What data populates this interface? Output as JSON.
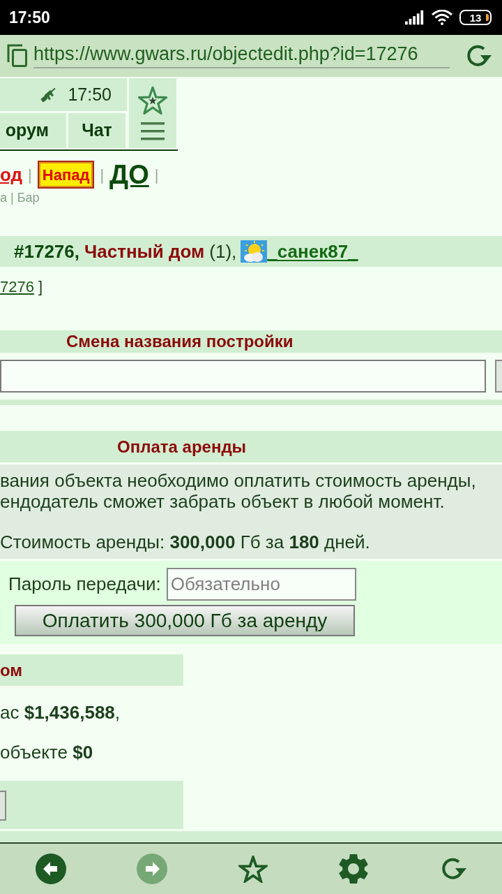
{
  "status_bar": {
    "time": "17:50",
    "battery": "13"
  },
  "address_bar": {
    "url": "https://www.gwars.ru/objectedit.php?id=17276"
  },
  "header": {
    "time": "17:50",
    "tabs": [
      {
        "label": "орум"
      },
      {
        "label": "Чат"
      }
    ]
  },
  "links": [
    {
      "label": "од",
      "kind": "alert",
      "separator": "|"
    },
    {
      "label": "Напад",
      "kind": "attack",
      "separator": "|"
    },
    {
      "label": "ДО",
      "kind": "big",
      "separator": "|"
    }
  ],
  "sublinks": "а | Бар",
  "object": {
    "number": "#17276,",
    "type": "Частный дом",
    "count": "(1),",
    "owner": "_санек87_",
    "link": "7276",
    "link_suffix": "]"
  },
  "rename": {
    "title": "Смена названия постройки"
  },
  "rent": {
    "title": "Оплата аренды",
    "notice": [
      "вания объекта необходимо оплатить стоимость аренды,",
      "ендодатель сможет забрать объект в любой момент."
    ],
    "cost": "Стоимость аренды: **300,000** Гб за **180** дней.",
    "password_label": "Пароль передачи:",
    "password_placeholder": "Обязательно",
    "pay_button": "Оплатить 300,000 Гб за аренду"
  },
  "money": {
    "title": "ом",
    "lines": [
      "ас **$1,436,588**,",
      "объекте **$0**"
    ]
  },
  "bottom_bar": [
    {
      "kind": "back",
      "disabled": false
    },
    {
      "kind": "forward",
      "disabled": true
    },
    {
      "kind": "bookmark",
      "disabled": false
    },
    {
      "kind": "settings",
      "disabled": false
    },
    {
      "kind": "reload",
      "disabled": false
    }
  ]
}
